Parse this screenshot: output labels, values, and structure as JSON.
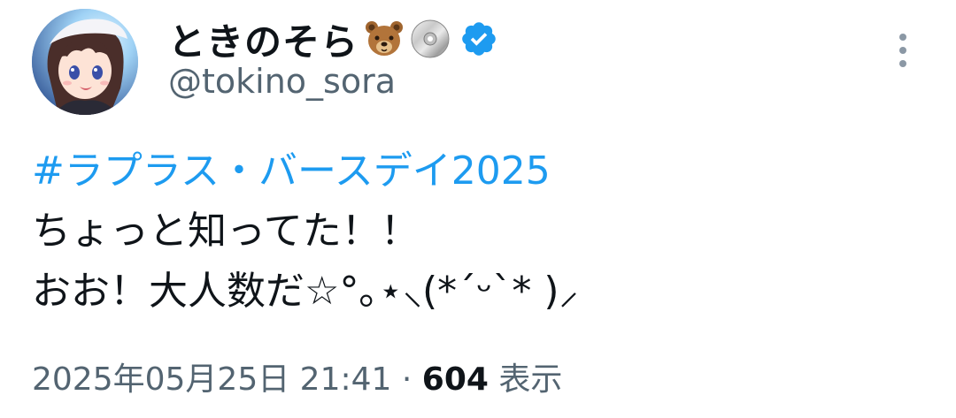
{
  "user": {
    "display_name": "ときのそら",
    "name_emojis": [
      "bear-face-emoji",
      "dvd-emoji"
    ],
    "badge": "verified-badge",
    "handle": "@tokino_sora"
  },
  "tweet": {
    "hashtag": "#ラプラス・バースデイ2025",
    "line2": "ちょっと知ってた！！",
    "line3": "おお！大人数だ☆°｡⋆⸜(*ˊᵕˋ* )⸝"
  },
  "meta": {
    "timestamp": "2025年05月25日 21:41",
    "separator": "·",
    "views_count": "604",
    "views_label": "表示"
  },
  "colors": {
    "link": "#1d9bf0",
    "text": "#0f1419",
    "secondary": "#536471",
    "verified": "#1d9bf0"
  }
}
